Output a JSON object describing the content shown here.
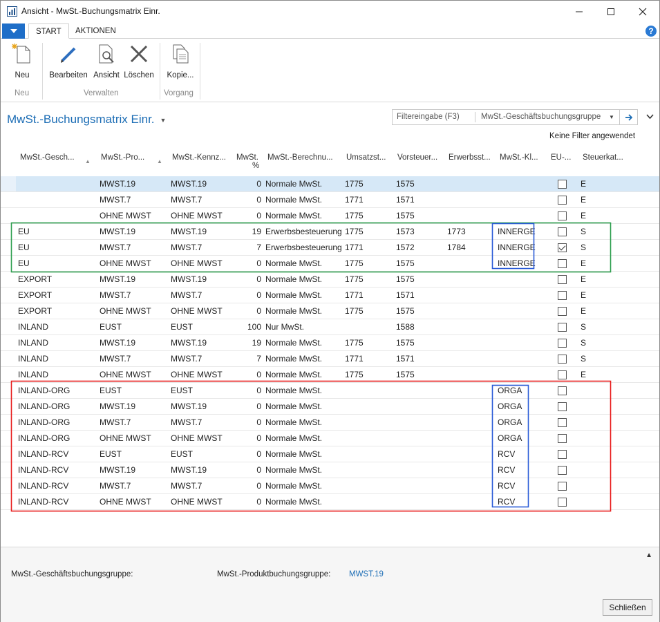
{
  "window": {
    "title": "Ansicht - MwSt.-Buchungsmatrix Einr."
  },
  "ribbon": {
    "tabs": [
      "START",
      "AKTIONEN"
    ],
    "buttons": {
      "new": "Neu",
      "edit": "Bearbeiten",
      "view": "Ansicht",
      "delete": "Löschen",
      "copy": "Kopie..."
    },
    "groups": {
      "new": "Neu",
      "manage": "Verwalten",
      "process": "Vorgang"
    }
  },
  "page": {
    "title": "MwSt.-Buchungsmatrix Einr.",
    "filter": {
      "placeholder": "Filtereingabe (F3)",
      "field": "MwSt.-Geschäftsbuchungsgruppe"
    },
    "no_filter": "Keine Filter angewendet"
  },
  "grid": {
    "headers": [
      "MwSt.-Gesch...",
      "MwSt.-Pro...",
      "MwSt.-Kennz...",
      "MwSt.",
      "%",
      "MwSt.-Berechnu...",
      "Umsatzst...",
      "Vorsteuer...",
      "Erwerbsst...",
      "MwSt.-Kl...",
      "EU-...",
      "Steuerkat..."
    ],
    "rows": [
      {
        "bus": "",
        "prod": "MWST.19",
        "id": "MWST.19",
        "pct": "0",
        "calc": "Normale MwSt.",
        "sales": "1775",
        "purch": "1575",
        "acq": "",
        "clause": "",
        "eu": false,
        "tax": "E"
      },
      {
        "bus": "",
        "prod": "MWST.7",
        "id": "MWST.7",
        "pct": "0",
        "calc": "Normale MwSt.",
        "sales": "1771",
        "purch": "1571",
        "acq": "",
        "clause": "",
        "eu": false,
        "tax": "E"
      },
      {
        "bus": "",
        "prod": "OHNE MWST",
        "id": "OHNE MWST",
        "pct": "0",
        "calc": "Normale MwSt.",
        "sales": "1775",
        "purch": "1575",
        "acq": "",
        "clause": "",
        "eu": false,
        "tax": "E"
      },
      {
        "bus": "EU",
        "prod": "MWST.19",
        "id": "MWST.19",
        "pct": "19",
        "calc": "Erwerbsbesteuerung",
        "sales": "1775",
        "purch": "1573",
        "acq": "1773",
        "clause": "INNERGE",
        "eu": false,
        "tax": "S"
      },
      {
        "bus": "EU",
        "prod": "MWST.7",
        "id": "MWST.7",
        "pct": "7",
        "calc": "Erwerbsbesteuerung",
        "sales": "1771",
        "purch": "1572",
        "acq": "1784",
        "clause": "INNERGE",
        "eu": true,
        "tax": "S"
      },
      {
        "bus": "EU",
        "prod": "OHNE MWST",
        "id": "OHNE MWST",
        "pct": "0",
        "calc": "Normale MwSt.",
        "sales": "1775",
        "purch": "1575",
        "acq": "",
        "clause": "INNERGE",
        "eu": false,
        "tax": "E"
      },
      {
        "bus": "EXPORT",
        "prod": "MWST.19",
        "id": "MWST.19",
        "pct": "0",
        "calc": "Normale MwSt.",
        "sales": "1775",
        "purch": "1575",
        "acq": "",
        "clause": "",
        "eu": false,
        "tax": "E"
      },
      {
        "bus": "EXPORT",
        "prod": "MWST.7",
        "id": "MWST.7",
        "pct": "0",
        "calc": "Normale MwSt.",
        "sales": "1771",
        "purch": "1571",
        "acq": "",
        "clause": "",
        "eu": false,
        "tax": "E"
      },
      {
        "bus": "EXPORT",
        "prod": "OHNE MWST",
        "id": "OHNE MWST",
        "pct": "0",
        "calc": "Normale MwSt.",
        "sales": "1775",
        "purch": "1575",
        "acq": "",
        "clause": "",
        "eu": false,
        "tax": "E"
      },
      {
        "bus": "INLAND",
        "prod": "EUST",
        "id": "EUST",
        "pct": "100",
        "calc": "Nur MwSt.",
        "sales": "",
        "purch": "1588",
        "acq": "",
        "clause": "",
        "eu": false,
        "tax": "S"
      },
      {
        "bus": "INLAND",
        "prod": "MWST.19",
        "id": "MWST.19",
        "pct": "19",
        "calc": "Normale MwSt.",
        "sales": "1775",
        "purch": "1575",
        "acq": "",
        "clause": "",
        "eu": false,
        "tax": "S"
      },
      {
        "bus": "INLAND",
        "prod": "MWST.7",
        "id": "MWST.7",
        "pct": "7",
        "calc": "Normale MwSt.",
        "sales": "1771",
        "purch": "1571",
        "acq": "",
        "clause": "",
        "eu": false,
        "tax": "S"
      },
      {
        "bus": "INLAND",
        "prod": "OHNE MWST",
        "id": "OHNE MWST",
        "pct": "0",
        "calc": "Normale MwSt.",
        "sales": "1775",
        "purch": "1575",
        "acq": "",
        "clause": "",
        "eu": false,
        "tax": "E"
      },
      {
        "bus": "INLAND-ORG",
        "prod": "EUST",
        "id": "EUST",
        "pct": "0",
        "calc": "Normale MwSt.",
        "sales": "",
        "purch": "",
        "acq": "",
        "clause": "ORGA",
        "eu": false,
        "tax": ""
      },
      {
        "bus": "INLAND-ORG",
        "prod": "MWST.19",
        "id": "MWST.19",
        "pct": "0",
        "calc": "Normale MwSt.",
        "sales": "",
        "purch": "",
        "acq": "",
        "clause": "ORGA",
        "eu": false,
        "tax": ""
      },
      {
        "bus": "INLAND-ORG",
        "prod": "MWST.7",
        "id": "MWST.7",
        "pct": "0",
        "calc": "Normale MwSt.",
        "sales": "",
        "purch": "",
        "acq": "",
        "clause": "ORGA",
        "eu": false,
        "tax": ""
      },
      {
        "bus": "INLAND-ORG",
        "prod": "OHNE MWST",
        "id": "OHNE MWST",
        "pct": "0",
        "calc": "Normale MwSt.",
        "sales": "",
        "purch": "",
        "acq": "",
        "clause": "ORGA",
        "eu": false,
        "tax": ""
      },
      {
        "bus": "INLAND-RCV",
        "prod": "EUST",
        "id": "EUST",
        "pct": "0",
        "calc": "Normale MwSt.",
        "sales": "",
        "purch": "",
        "acq": "",
        "clause": "RCV",
        "eu": false,
        "tax": ""
      },
      {
        "bus": "INLAND-RCV",
        "prod": "MWST.19",
        "id": "MWST.19",
        "pct": "0",
        "calc": "Normale MwSt.",
        "sales": "",
        "purch": "",
        "acq": "",
        "clause": "RCV",
        "eu": false,
        "tax": ""
      },
      {
        "bus": "INLAND-RCV",
        "prod": "MWST.7",
        "id": "MWST.7",
        "pct": "0",
        "calc": "Normale MwSt.",
        "sales": "",
        "purch": "",
        "acq": "",
        "clause": "RCV",
        "eu": false,
        "tax": ""
      },
      {
        "bus": "INLAND-RCV",
        "prod": "OHNE MWST",
        "id": "OHNE MWST",
        "pct": "0",
        "calc": "Normale MwSt.",
        "sales": "",
        "purch": "",
        "acq": "",
        "clause": "RCV",
        "eu": false,
        "tax": ""
      }
    ]
  },
  "factbox": {
    "bus_label": "MwSt.-Geschäftsbuchungsgruppe:",
    "prod_label": "MwSt.-Produktbuchungsgruppe:",
    "prod_value": "MWST.19"
  },
  "close_label": "Schließen",
  "colors": {
    "accent": "#1c6db5",
    "selected_row": "#d6e8f7",
    "highlight_green": "#2e9e4f",
    "highlight_red": "#e81c1c",
    "highlight_blue": "#2a5bd7"
  }
}
